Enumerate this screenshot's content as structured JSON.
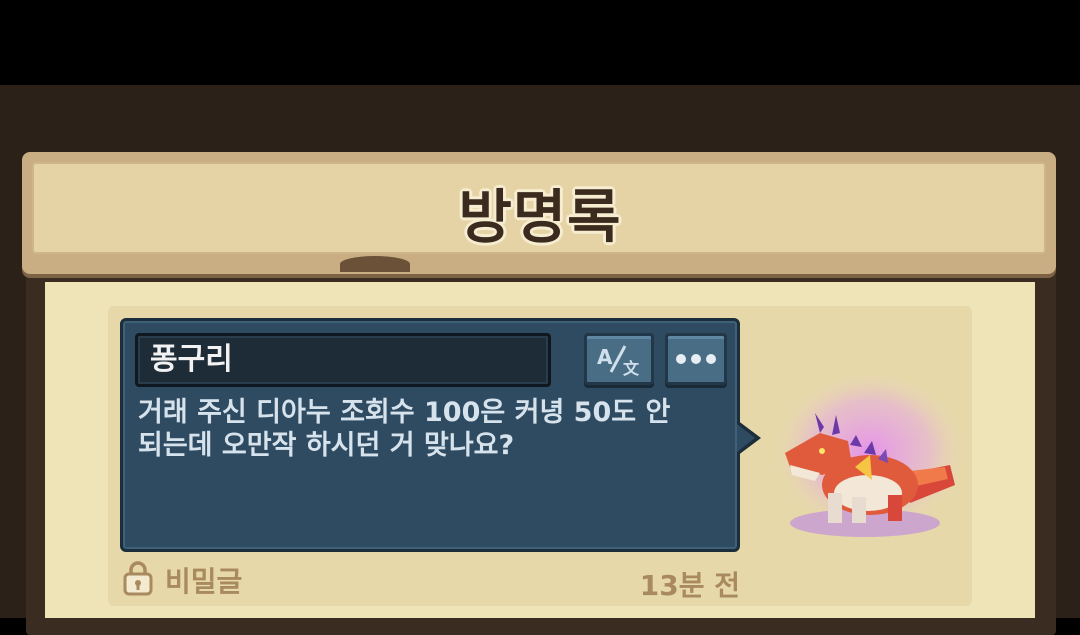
{
  "header": {
    "title": "방명록"
  },
  "entry": {
    "author": "퐁구리",
    "message_line1": "거래 주신 디아누 조회수 100은 커녕 50도 안",
    "message_line2": "되는데 오만작 하시던 거 맞나요?",
    "translate_icon": "translate-icon",
    "more_icon": "more-dots-icon",
    "secret_label": "비밀글",
    "secret_icon": "lock-icon",
    "time_ago": "13분 전",
    "avatar_icon": "dragon-pet-icon"
  },
  "colors": {
    "bubble": "#2f4b62",
    "paper": "#efe3b8",
    "banner": "#e6d3a5",
    "meta_text": "#a98a5e"
  }
}
